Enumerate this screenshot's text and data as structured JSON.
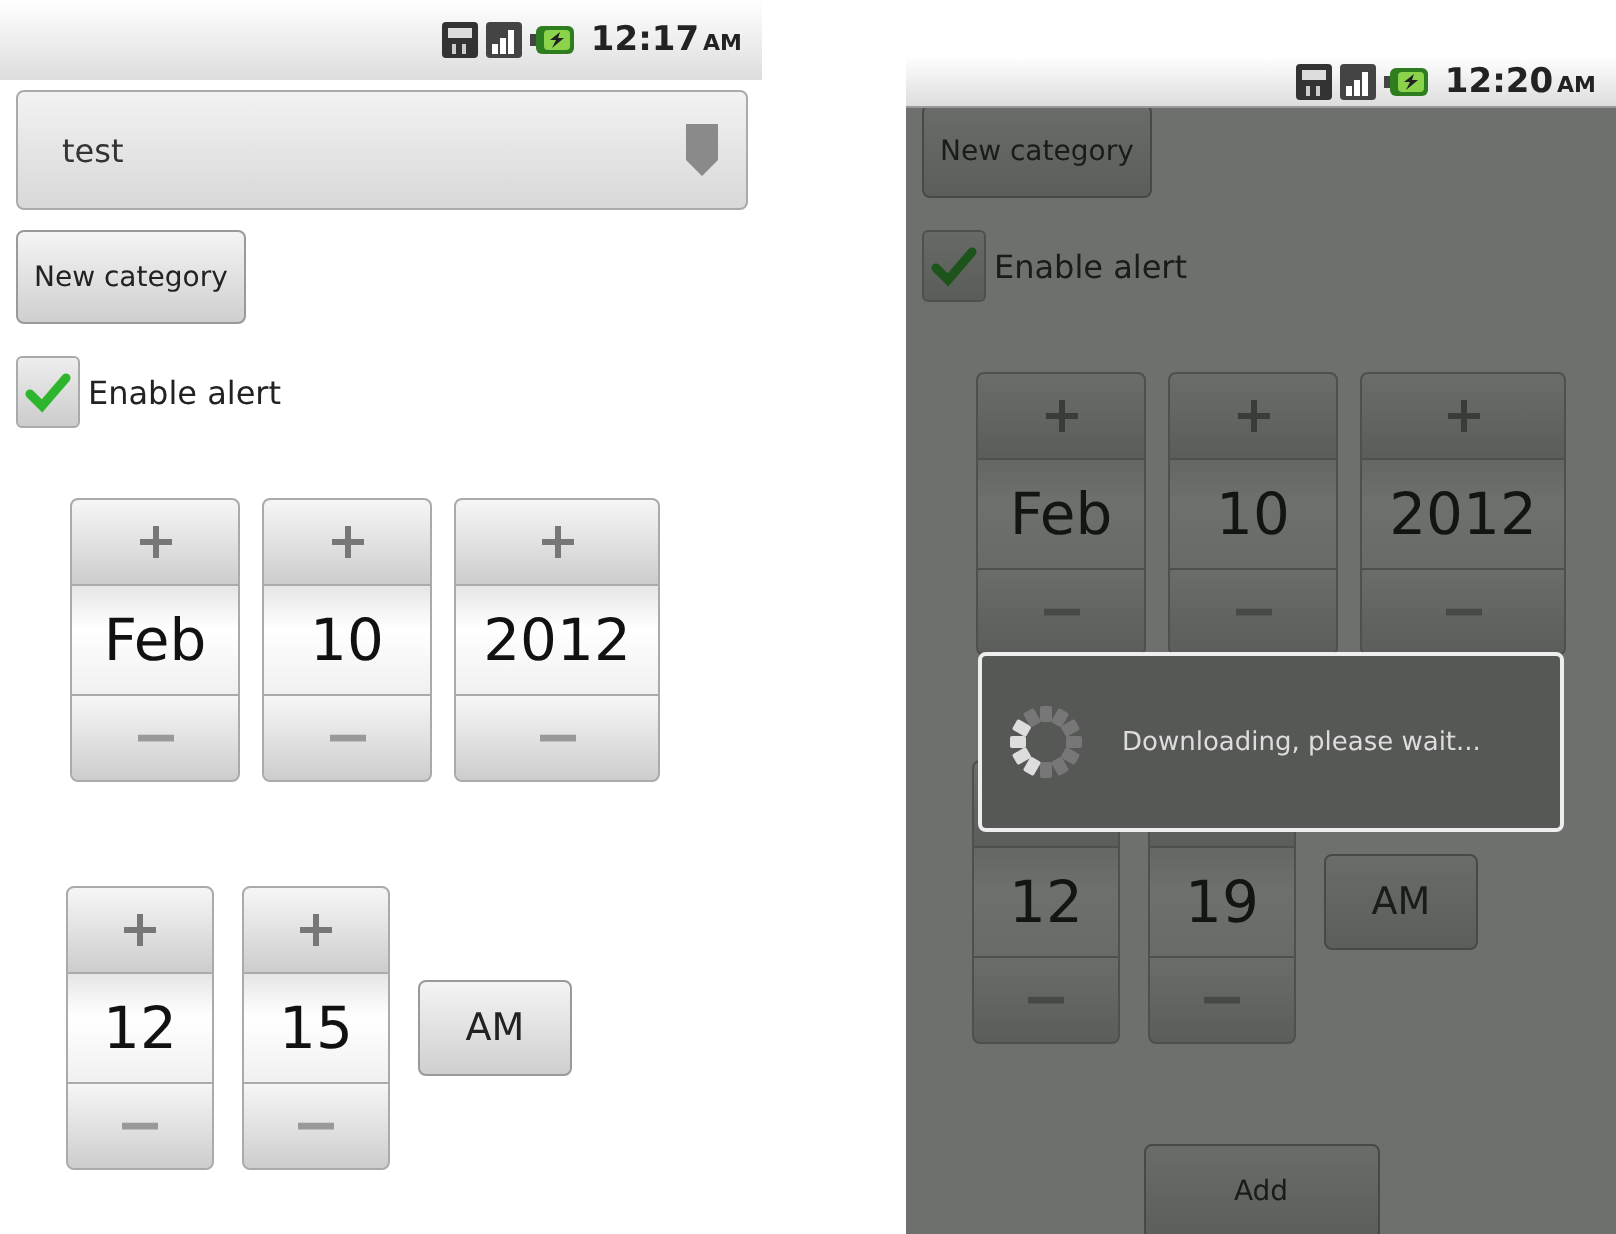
{
  "screens": [
    {
      "status_bar": {
        "time": "12:17",
        "meridiem": "AM"
      },
      "category_spinner": {
        "value": "test"
      },
      "new_category_button": "New category",
      "enable_alert": {
        "label": "Enable alert",
        "checked": true
      },
      "date_pickers": [
        {
          "value": "Feb"
        },
        {
          "value": "10"
        },
        {
          "value": "2012"
        }
      ],
      "time_pickers": [
        {
          "value": "12"
        },
        {
          "value": "15"
        }
      ],
      "ampm_button": "AM"
    },
    {
      "dimmed": true,
      "status_bar": {
        "time": "12:20",
        "meridiem": "AM"
      },
      "new_category_button": "New category",
      "enable_alert": {
        "label": "Enable alert",
        "checked": true
      },
      "date_pickers": [
        {
          "value": "Feb"
        },
        {
          "value": "10"
        },
        {
          "value": "2012"
        }
      ],
      "time_pickers": [
        {
          "value": "12"
        },
        {
          "value": "19"
        }
      ],
      "ampm_button": "AM",
      "add_button": "Add",
      "progress_dialog": {
        "message": "Downloading, please wait..."
      }
    }
  ]
}
